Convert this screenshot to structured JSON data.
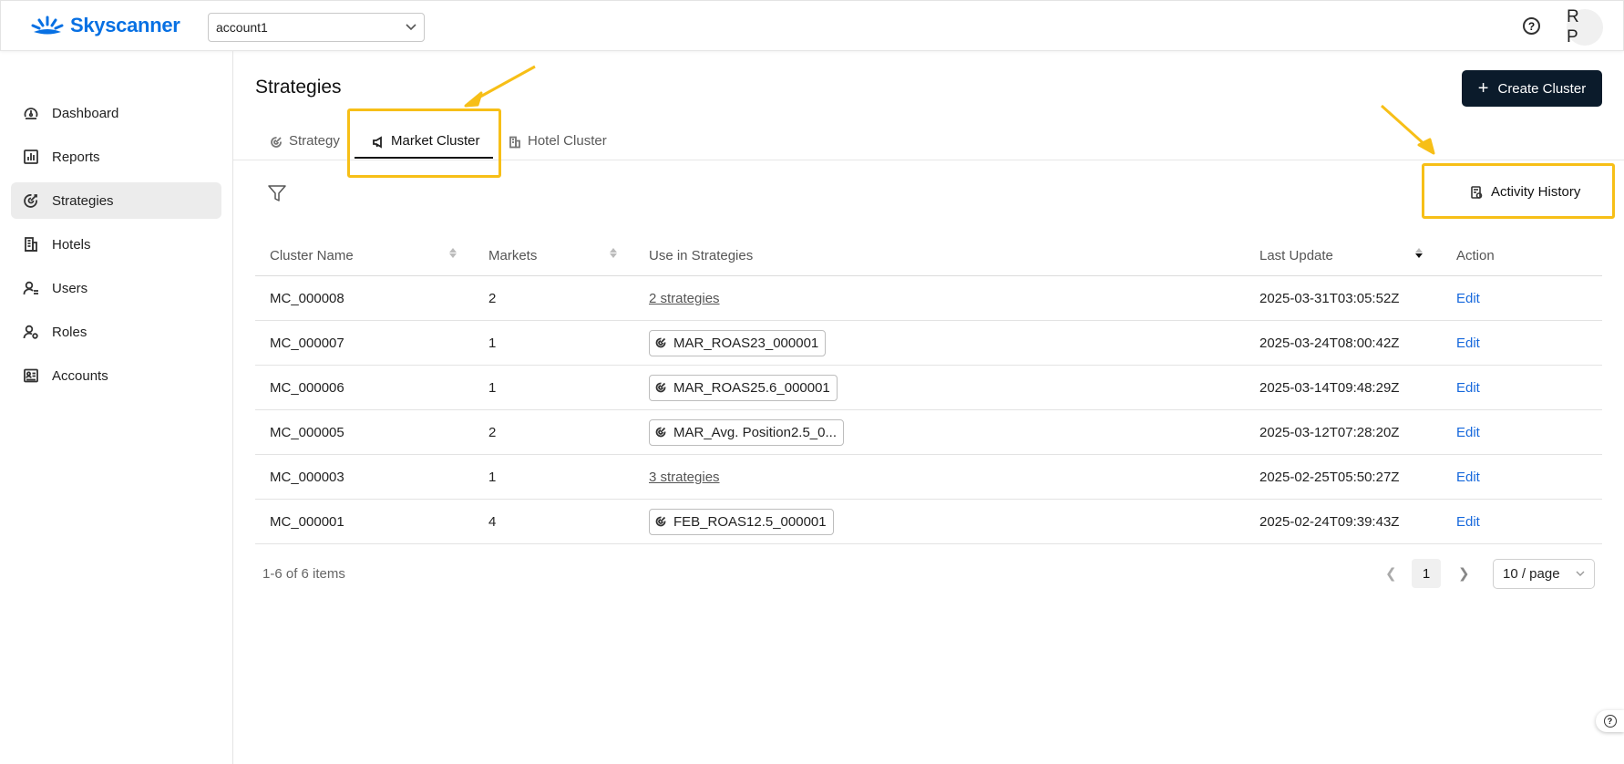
{
  "brand": {
    "name": "Skyscanner",
    "color": "#0770e3"
  },
  "header": {
    "account_value": "account1",
    "help_icon": "question-circle-icon",
    "avatar_initials": "R P"
  },
  "sidebar": {
    "items": [
      {
        "label": "Dashboard",
        "icon": "dashboard-icon"
      },
      {
        "label": "Reports",
        "icon": "bar-chart-icon"
      },
      {
        "label": "Strategies",
        "icon": "target-icon",
        "active": true
      },
      {
        "label": "Hotels",
        "icon": "building-icon"
      },
      {
        "label": "Users",
        "icon": "user-list-icon"
      },
      {
        "label": "Roles",
        "icon": "user-role-icon"
      },
      {
        "label": "Accounts",
        "icon": "id-card-icon"
      }
    ]
  },
  "main": {
    "title": "Strategies",
    "create_button": "Create Cluster",
    "tabs": [
      {
        "label": "Strategy",
        "icon": "target-icon"
      },
      {
        "label": "Market Cluster",
        "icon": "megaphone-icon",
        "active": true
      },
      {
        "label": "Hotel Cluster",
        "icon": "building-icon"
      }
    ],
    "activity_history": "Activity History"
  },
  "table": {
    "columns": [
      "Cluster Name",
      "Markets",
      "Use in Strategies",
      "Last Update",
      "Action"
    ],
    "rows": [
      {
        "name": "MC_000008",
        "markets": "2",
        "strategies": "2 strategies",
        "strategies_type": "link",
        "updated": "2025-03-31T03:05:52Z",
        "action": "Edit"
      },
      {
        "name": "MC_000007",
        "markets": "1",
        "strategies": "MAR_ROAS23_000001",
        "strategies_type": "chip",
        "updated": "2025-03-24T08:00:42Z",
        "action": "Edit"
      },
      {
        "name": "MC_000006",
        "markets": "1",
        "strategies": "MAR_ROAS25.6_000001",
        "strategies_type": "chip",
        "updated": "2025-03-14T09:48:29Z",
        "action": "Edit"
      },
      {
        "name": "MC_000005",
        "markets": "2",
        "strategies": "MAR_Avg. Position2.5_0...",
        "strategies_type": "chip",
        "updated": "2025-03-12T07:28:20Z",
        "action": "Edit"
      },
      {
        "name": "MC_000003",
        "markets": "1",
        "strategies": "3 strategies",
        "strategies_type": "link",
        "updated": "2025-02-25T05:50:27Z",
        "action": "Edit"
      },
      {
        "name": "MC_000001",
        "markets": "4",
        "strategies": "FEB_ROAS12.5_000001",
        "strategies_type": "chip",
        "updated": "2025-02-24T09:39:43Z",
        "action": "Edit"
      }
    ]
  },
  "pagination": {
    "summary": "1-6 of 6 items",
    "current_page": "1",
    "page_size": "10 / page"
  },
  "colors": {
    "highlight": "#f7bf17",
    "edit_link": "#1668dc",
    "primary_button": "#0b1b2b"
  }
}
